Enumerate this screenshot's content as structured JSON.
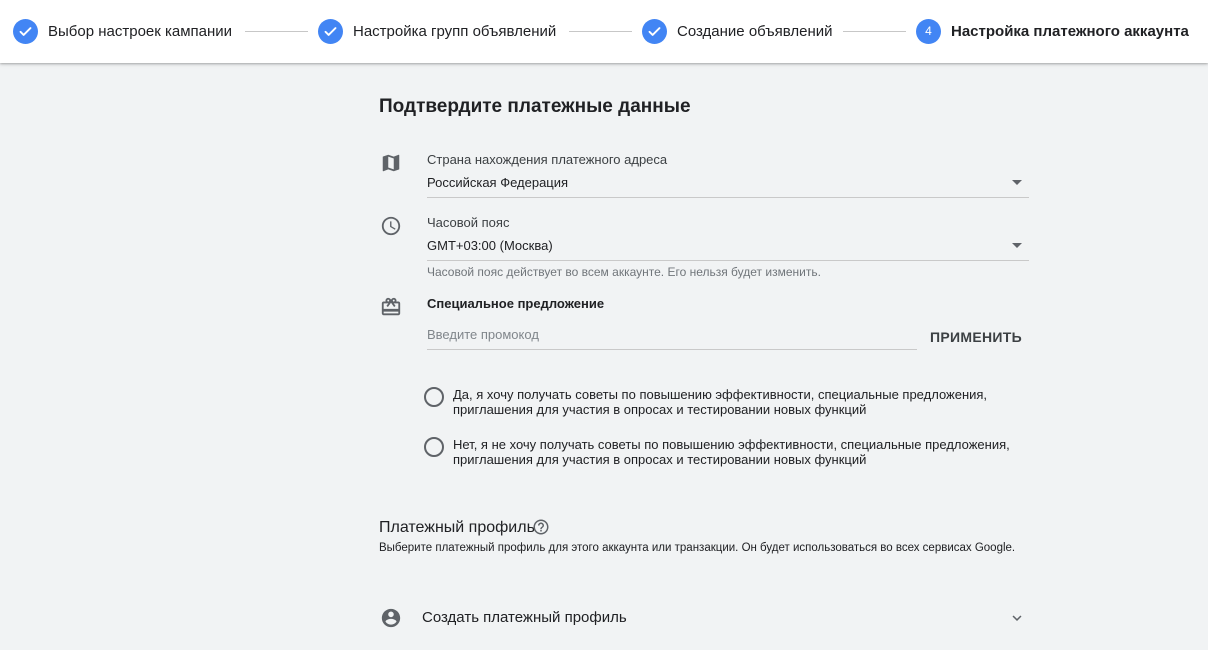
{
  "stepper": {
    "steps": [
      {
        "label": "Выбор настроек кампании",
        "status": "completed"
      },
      {
        "label": "Настройка групп объявлений",
        "status": "completed"
      },
      {
        "label": "Создание объявлений",
        "status": "completed"
      },
      {
        "label": "Настройка платежного аккаунта",
        "status": "active",
        "number": "4"
      }
    ]
  },
  "page": {
    "title": "Подтвердите платежные данные"
  },
  "country": {
    "label": "Страна нахождения платежного адреса",
    "value": "Российская Федерация",
    "icon": "map-icon"
  },
  "timezone": {
    "label": "Часовой пояс",
    "value": "GMT+03:00 (Москва)",
    "hint": "Часовой пояс действует во всем аккаунте. Его нельзя будет изменить.",
    "icon": "clock-icon"
  },
  "promo": {
    "label": "Специальное предложение",
    "placeholder": "Введите промокод",
    "apply_label": "ПРИМЕНИТЬ",
    "icon": "gift-card-icon"
  },
  "consent": {
    "options": [
      {
        "text": "Да, я хочу получать советы по повышению эффективности, специальные предложения, приглашения для участия в опросах и тестировании новых функций",
        "selected": false
      },
      {
        "text": "Нет, я не хочу получать советы по повышению эффективности, специальные предложения, приглашения для участия в опросах и тестировании новых функций",
        "selected": false
      }
    ]
  },
  "payment_profile": {
    "title": "Платежный профиль",
    "description": "Выберите платежный профиль для этого аккаунта или транзакции. Он будет использоваться во всех сервисах Google.",
    "create_label": "Создать платежный профиль",
    "icon": "account-circle-icon"
  },
  "colors": {
    "accent": "#4285f4",
    "background": "#f1f3f4",
    "header_bg": "#ffffff"
  }
}
